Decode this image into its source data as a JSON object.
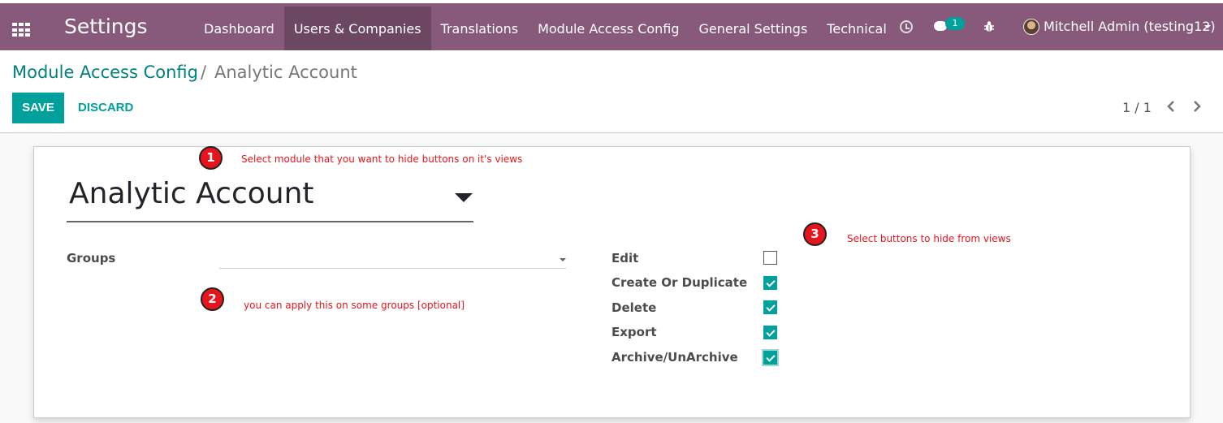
{
  "navbar": {
    "app_title": "Settings",
    "menu": [
      {
        "label": "Dashboard"
      },
      {
        "label": "Users & Companies"
      },
      {
        "label": "Translations"
      },
      {
        "label": "Module Access Config"
      },
      {
        "label": "General Settings"
      },
      {
        "label": "Technical"
      }
    ],
    "active_menu": "Users & Companies",
    "chat_badge": "1",
    "user": "Mitchell Admin (testing12)",
    "accent_color": "#875a7b"
  },
  "breadcrumb": {
    "parent": "Module Access Config",
    "separator": "/",
    "current": "Analytic Account"
  },
  "buttons": {
    "save": "SAVE",
    "discard": "DISCARD"
  },
  "pager": {
    "value": "1 / 1"
  },
  "form": {
    "model": "Analytic Account",
    "groups_label": "Groups",
    "groups_value": "",
    "options": [
      {
        "label": "Edit",
        "checked": false
      },
      {
        "label": "Create Or Duplicate",
        "checked": true
      },
      {
        "label": "Delete",
        "checked": true
      },
      {
        "label": "Export",
        "checked": true
      },
      {
        "label": "Archive/UnArchive",
        "checked": true
      }
    ]
  },
  "annotations": [
    {
      "number": "1",
      "text": "Select module that you want to hide buttons on it's views"
    },
    {
      "number": "2",
      "text": "you can apply this on some groups [optional]"
    },
    {
      "number": "3",
      "text": "Select buttons to hide from views"
    }
  ],
  "colors": {
    "primary": "#00a09d",
    "marker": "#e8141c"
  }
}
